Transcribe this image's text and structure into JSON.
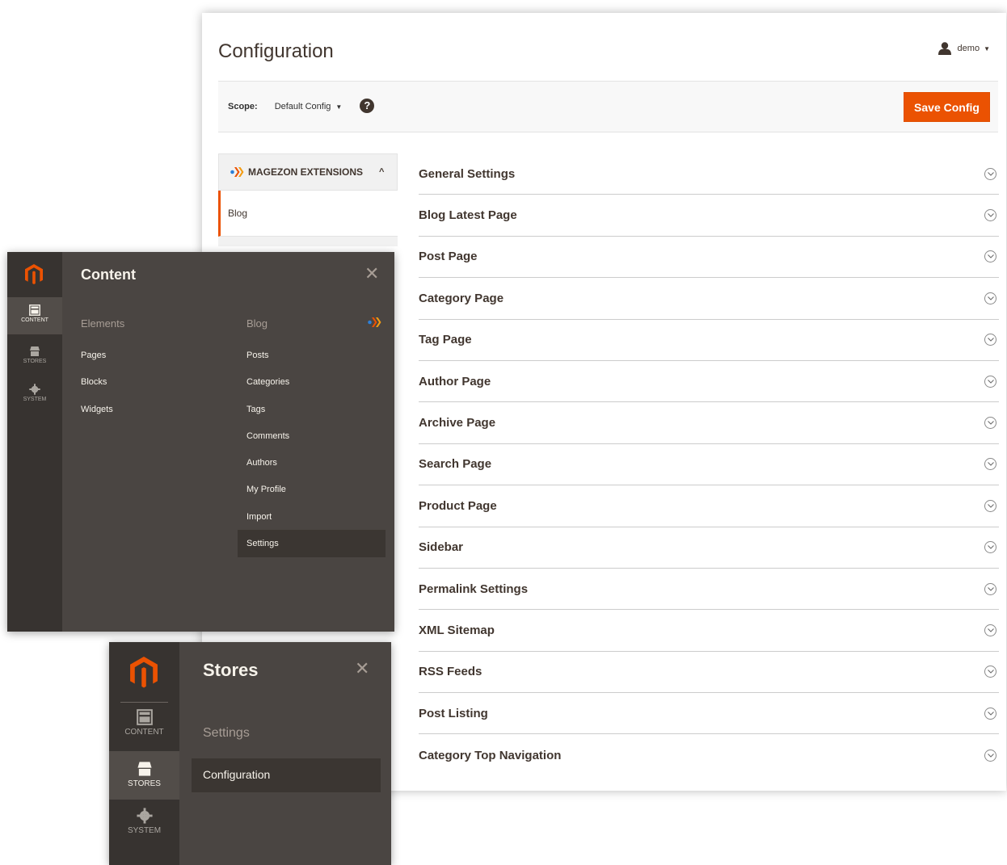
{
  "config": {
    "title": "Configuration",
    "user": "demo",
    "scope_label": "Scope:",
    "scope_value": "Default Config",
    "save_label": "Save Config",
    "tab_group": "MAGEZON EXTENSIONS",
    "tab_item": "Blog",
    "sections": [
      "General Settings",
      "Blog Latest Page",
      "Post Page",
      "Category Page",
      "Tag Page",
      "Author Page",
      "Archive Page",
      "Search Page",
      "Product Page",
      "Sidebar",
      "Permalink Settings",
      "XML Sitemap",
      "RSS Feeds",
      "Post Listing",
      "Category Top Navigation"
    ]
  },
  "content_menu": {
    "title": "Content",
    "rail": [
      "CONTENT",
      "STORES",
      "SYSTEM"
    ],
    "elements_heading": "Elements",
    "elements": [
      "Pages",
      "Blocks",
      "Widgets"
    ],
    "blog_heading": "Blog",
    "blog": [
      "Posts",
      "Categories",
      "Tags",
      "Comments",
      "Authors",
      "My Profile",
      "Import",
      "Settings"
    ]
  },
  "stores_menu": {
    "title": "Stores",
    "rail": [
      "CONTENT",
      "STORES",
      "SYSTEM"
    ],
    "settings_heading": "Settings",
    "settings": [
      "Configuration"
    ]
  },
  "colors": {
    "accent": "#eb5202",
    "menu_bg": "#4a4542",
    "rail_bg": "#373330"
  }
}
